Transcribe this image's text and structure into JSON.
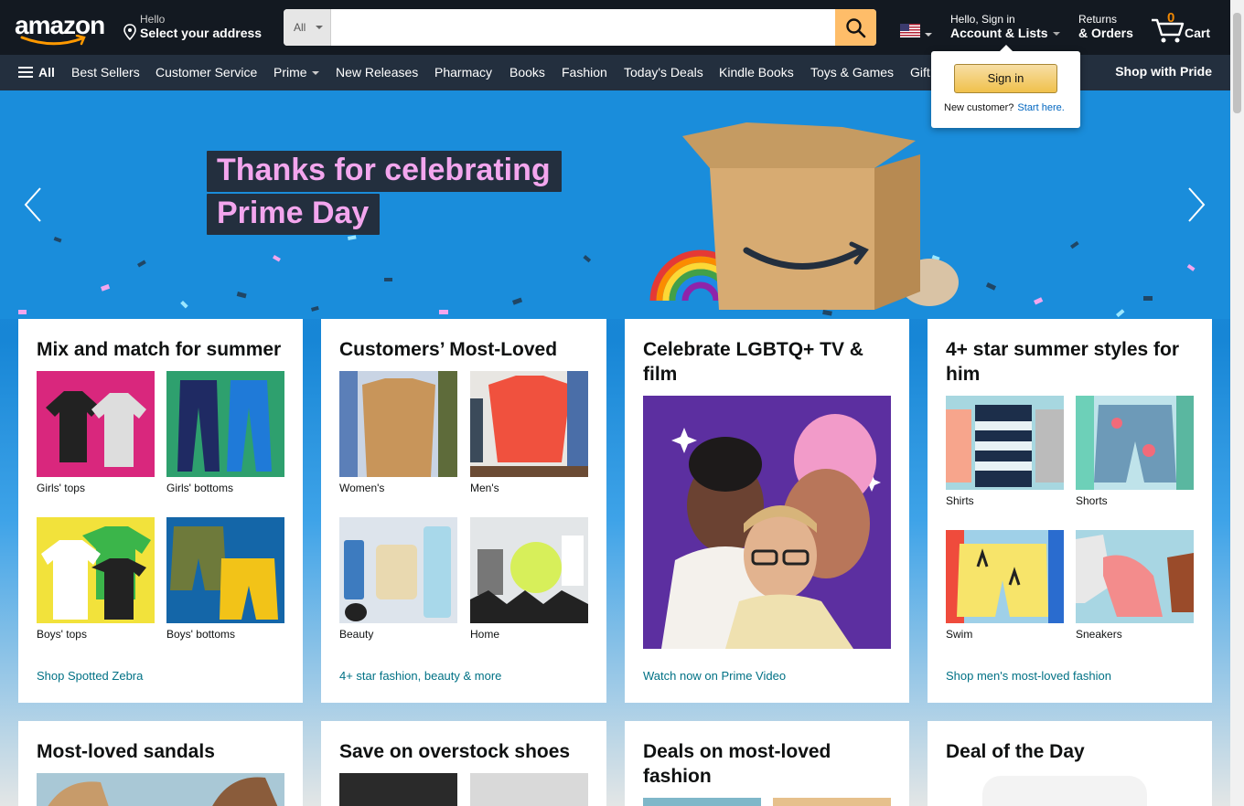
{
  "nav": {
    "logo": "amazon",
    "address_hello": "Hello",
    "address_select": "Select your address",
    "search_category": "All",
    "search_placeholder": "",
    "account_hello": "Hello, Sign in",
    "account_lists": "Account & Lists",
    "returns_l1": "Returns",
    "returns_l2": "& Orders",
    "cart_count": "0",
    "cart_label": "Cart"
  },
  "subnav": {
    "all": "All",
    "items": [
      "Best Sellers",
      "Customer Service",
      "Prime",
      "New Releases",
      "Pharmacy",
      "Books",
      "Fashion",
      "Today's Deals",
      "Kindle Books",
      "Toys & Games",
      "Gift"
    ],
    "pride": "Shop with Pride"
  },
  "popover": {
    "signin": "Sign in",
    "new_customer": "New customer?",
    "start_here": "Start here."
  },
  "hero": {
    "line1": "Thanks for celebrating",
    "line2": "Prime Day"
  },
  "cards": [
    {
      "title": "Mix and match for summer",
      "tiles": [
        "Girls' tops",
        "Girls' bottoms",
        "Boys' tops",
        "Boys' bottoms"
      ],
      "link": "Shop Spotted Zebra"
    },
    {
      "title": "Customers’ Most-Loved",
      "tiles": [
        "Women's",
        "Men's",
        "Beauty",
        "Home"
      ],
      "link": "4+ star fashion, beauty & more"
    },
    {
      "title": "Celebrate LGBTQ+ TV & film",
      "link": "Watch now on Prime Video"
    },
    {
      "title": "4+ star summer styles for him",
      "tiles": [
        "Shirts",
        "Shorts",
        "Swim",
        "Sneakers"
      ],
      "link": "Shop men's most-loved fashion"
    },
    {
      "title": "Most-loved sandals"
    },
    {
      "title": "Save on overstock shoes"
    },
    {
      "title": "Deals on most-loved fashion"
    },
    {
      "title": "Deal of the Day"
    }
  ],
  "colors": {
    "nav_bg": "#131921",
    "subnav_bg": "#232f3e",
    "search_button": "#febd69",
    "link": "#007185",
    "hero_blue": "#1a8ddb",
    "hero_title_pink": "#f3a6ee"
  }
}
